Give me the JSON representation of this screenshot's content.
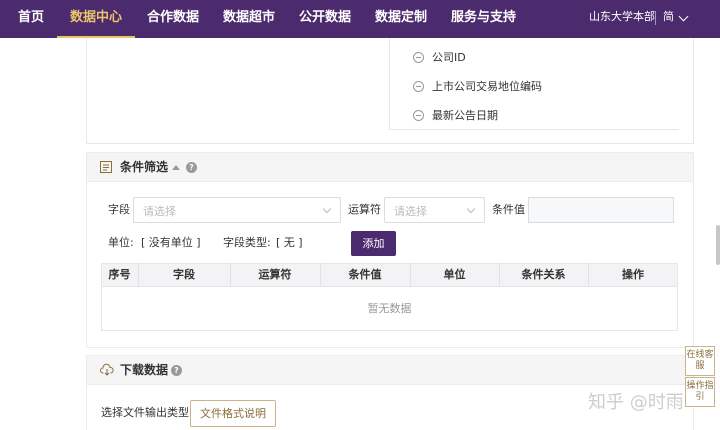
{
  "nav": {
    "items": [
      "首页",
      "数据中心",
      "合作数据",
      "数据超市",
      "公开数据",
      "数据定制",
      "服务与支持"
    ],
    "active_index": 1,
    "org": "山东大学本部",
    "lang": "简"
  },
  "field_list": {
    "items": [
      "公司ID",
      "上市公司交易地位编码",
      "最新公告日期"
    ]
  },
  "filter": {
    "title": "条件筛选",
    "field_label": "字段",
    "field_placeholder": "请选择",
    "operator_label": "运算符",
    "operator_placeholder": "请选择",
    "value_label": "条件值",
    "unit_label": "单位:",
    "unit_value": "[ 没有单位 ]",
    "type_label": "字段类型:",
    "type_value": "[ 无 ]",
    "add_button": "添加",
    "table_headers": [
      "序号",
      "字段",
      "运算符",
      "条件值",
      "单位",
      "条件关系",
      "操作"
    ],
    "empty_text": "暂无数据"
  },
  "download": {
    "title": "下载数据",
    "file_type_label": "选择文件输出类型",
    "format_button": "文件格式说明"
  },
  "side": {
    "online_service": "在线客服",
    "guide": "操作指引"
  },
  "watermark": "知乎 @时雨",
  "colors": {
    "nav_bg": "#4b2a6e",
    "nav_active": "#e8c46a",
    "primary": "#4b2a6e",
    "accent_border": "#c9b48a"
  }
}
